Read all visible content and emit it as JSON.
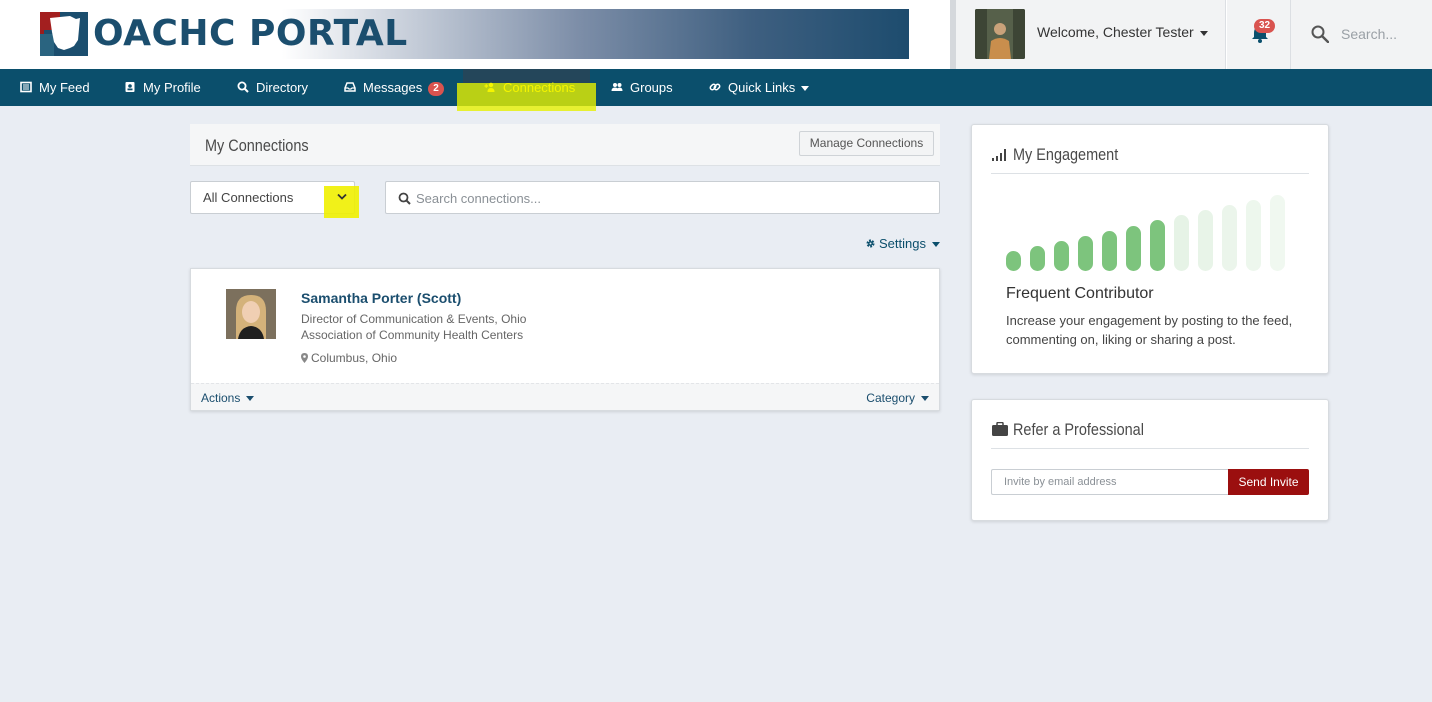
{
  "header": {
    "logo_text": "OACHC PORTAL",
    "welcome": "Welcome, Chester Tester",
    "notification_count": "32",
    "search_placeholder": "Search..."
  },
  "nav": {
    "items": [
      {
        "label": "My Feed",
        "icon": "newspaper-icon"
      },
      {
        "label": "My Profile",
        "icon": "profile-card-icon"
      },
      {
        "label": "Directory",
        "icon": "search-icon"
      },
      {
        "label": "Messages",
        "icon": "inbox-icon",
        "badge": "2"
      },
      {
        "label": "Connections",
        "icon": "user-plus-icon",
        "active": true
      },
      {
        "label": "Groups",
        "icon": "users-icon"
      },
      {
        "label": "Quick Links",
        "icon": "link-icon",
        "dropdown": true
      }
    ]
  },
  "connections": {
    "title": "My Connections",
    "manage_label": "Manage Connections",
    "filter_selected": "All Connections",
    "search_placeholder": "Search connections...",
    "settings_label": "Settings",
    "list": [
      {
        "name": "Samantha Porter (Scott)",
        "title_line1": "Director of Communication & Events, Ohio",
        "title_line2": "Association of Community Health Centers",
        "location": "Columbus, Ohio",
        "actions_label": "Actions",
        "category_label": "Category"
      }
    ]
  },
  "engagement": {
    "title": "My Engagement",
    "level": "Frequent Contributor",
    "level_index": 7,
    "total_levels": 12,
    "description": "Increase your engagement by posting to the feed, commenting on, liking or sharing a post."
  },
  "refer": {
    "title": "Refer a Professional",
    "input_placeholder": "Invite by email address",
    "button_label": "Send Invite"
  },
  "colors": {
    "nav_bg": "#0b4f6c",
    "brand_red": "#9b0f0f",
    "badge_red": "#d9534f",
    "active_text": "#f5f500",
    "bar_active": "#7dc47d",
    "bar_inactive": "#e6f3e6"
  }
}
